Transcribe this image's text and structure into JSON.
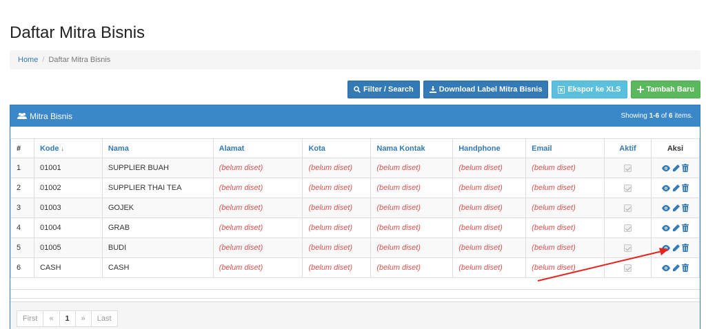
{
  "page": {
    "title": "Daftar Mitra Bisnis"
  },
  "breadcrumb": {
    "home": "Home",
    "separator": "/",
    "current": "Daftar Mitra Bisnis"
  },
  "toolbar": {
    "filter": "Filter / Search",
    "download": "Download Label Mitra Bisnis",
    "export": "Ekspor ke XLS",
    "add": "Tambah Baru"
  },
  "panel": {
    "title": "Mitra Bisnis",
    "summary_prefix": "Showing ",
    "summary_range": "1-6",
    "summary_mid": " of ",
    "summary_total": "6",
    "summary_suffix": " items."
  },
  "table": {
    "headers": {
      "num": "#",
      "kode": "Kode",
      "nama": "Nama",
      "alamat": "Alamat",
      "kota": "Kota",
      "kontak": "Nama Kontak",
      "hp": "Handphone",
      "email": "Email",
      "aktif": "Aktif",
      "aksi": "Aksi"
    },
    "sort_glyph": "↓",
    "empty": "(belum diset)",
    "rows": [
      {
        "num": "1",
        "kode": "01001",
        "nama": "SUPPLIER BUAH"
      },
      {
        "num": "2",
        "kode": "01002",
        "nama": "SUPPLIER THAI TEA"
      },
      {
        "num": "3",
        "kode": "01003",
        "nama": "GOJEK"
      },
      {
        "num": "4",
        "kode": "01004",
        "nama": "GRAB"
      },
      {
        "num": "5",
        "kode": "01005",
        "nama": "BUDI"
      },
      {
        "num": "6",
        "kode": "CASH",
        "nama": "CASH"
      }
    ]
  },
  "pagination": {
    "first": "First",
    "prev": "«",
    "page": "1",
    "next": "»",
    "last": "Last"
  },
  "colors": {
    "primary": "#337ab7",
    "info": "#5bc0de",
    "success": "#5cb85c",
    "annotation": "#e8231d"
  },
  "icons": [
    "search-icon",
    "download-icon",
    "file-excel-icon",
    "plus-icon",
    "users-icon",
    "eye-icon",
    "pencil-icon",
    "trash-icon"
  ]
}
